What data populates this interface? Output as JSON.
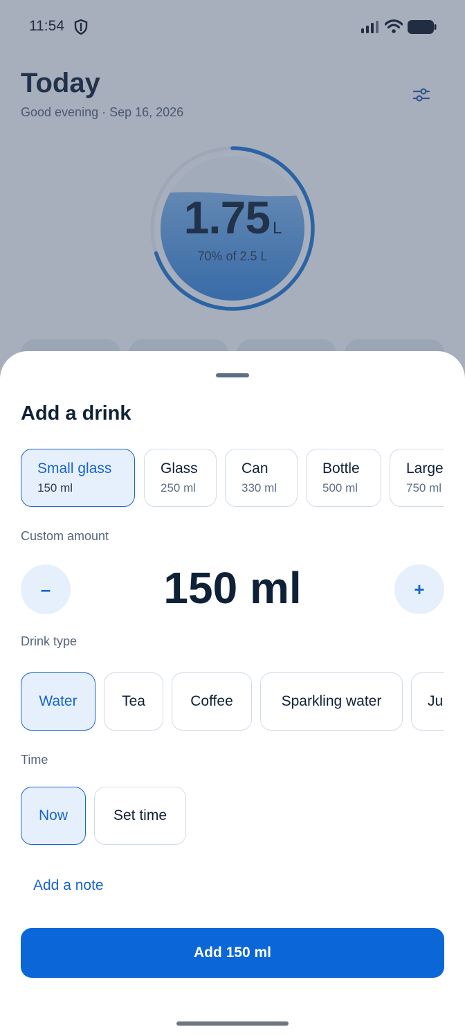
{
  "status_bar": {
    "time": "11:54"
  },
  "header": {
    "title": "Today",
    "subtitle": "Good evening · Sep 16, 2026"
  },
  "progress": {
    "value": "1.75",
    "unit": "L",
    "caption": "70% of 2.5 L",
    "fraction": 0.7
  },
  "sheet": {
    "title": "Add a drink",
    "presets": [
      {
        "name": "Small glass",
        "volume": "150 ml",
        "selected": true
      },
      {
        "name": "Glass",
        "volume": "250 ml",
        "selected": false
      },
      {
        "name": "Can",
        "volume": "330 ml",
        "selected": false
      },
      {
        "name": "Bottle",
        "volume": "500 ml",
        "selected": false
      },
      {
        "name": "Large",
        "volume": "750 ml",
        "selected": false
      }
    ],
    "custom_amount_label": "Custom amount",
    "decrement_label": "–",
    "increment_label": "+",
    "amount": "150 ml",
    "drink_type_label": "Drink type",
    "drink_types": [
      {
        "label": "Water",
        "selected": true
      },
      {
        "label": "Tea",
        "selected": false
      },
      {
        "label": "Coffee",
        "selected": false
      },
      {
        "label": "Sparkling water",
        "selected": false
      },
      {
        "label": "Ju",
        "selected": false
      }
    ],
    "time_label": "Time",
    "time_options": [
      {
        "label": "Now",
        "selected": true
      },
      {
        "label": "Set time",
        "selected": false
      }
    ],
    "note_link": "Add a note",
    "primary_button": "Add 150 ml"
  },
  "colors": {
    "accent": "#0b66d8",
    "accent_soft": "#e6f0fc",
    "text": "#0f2137"
  }
}
